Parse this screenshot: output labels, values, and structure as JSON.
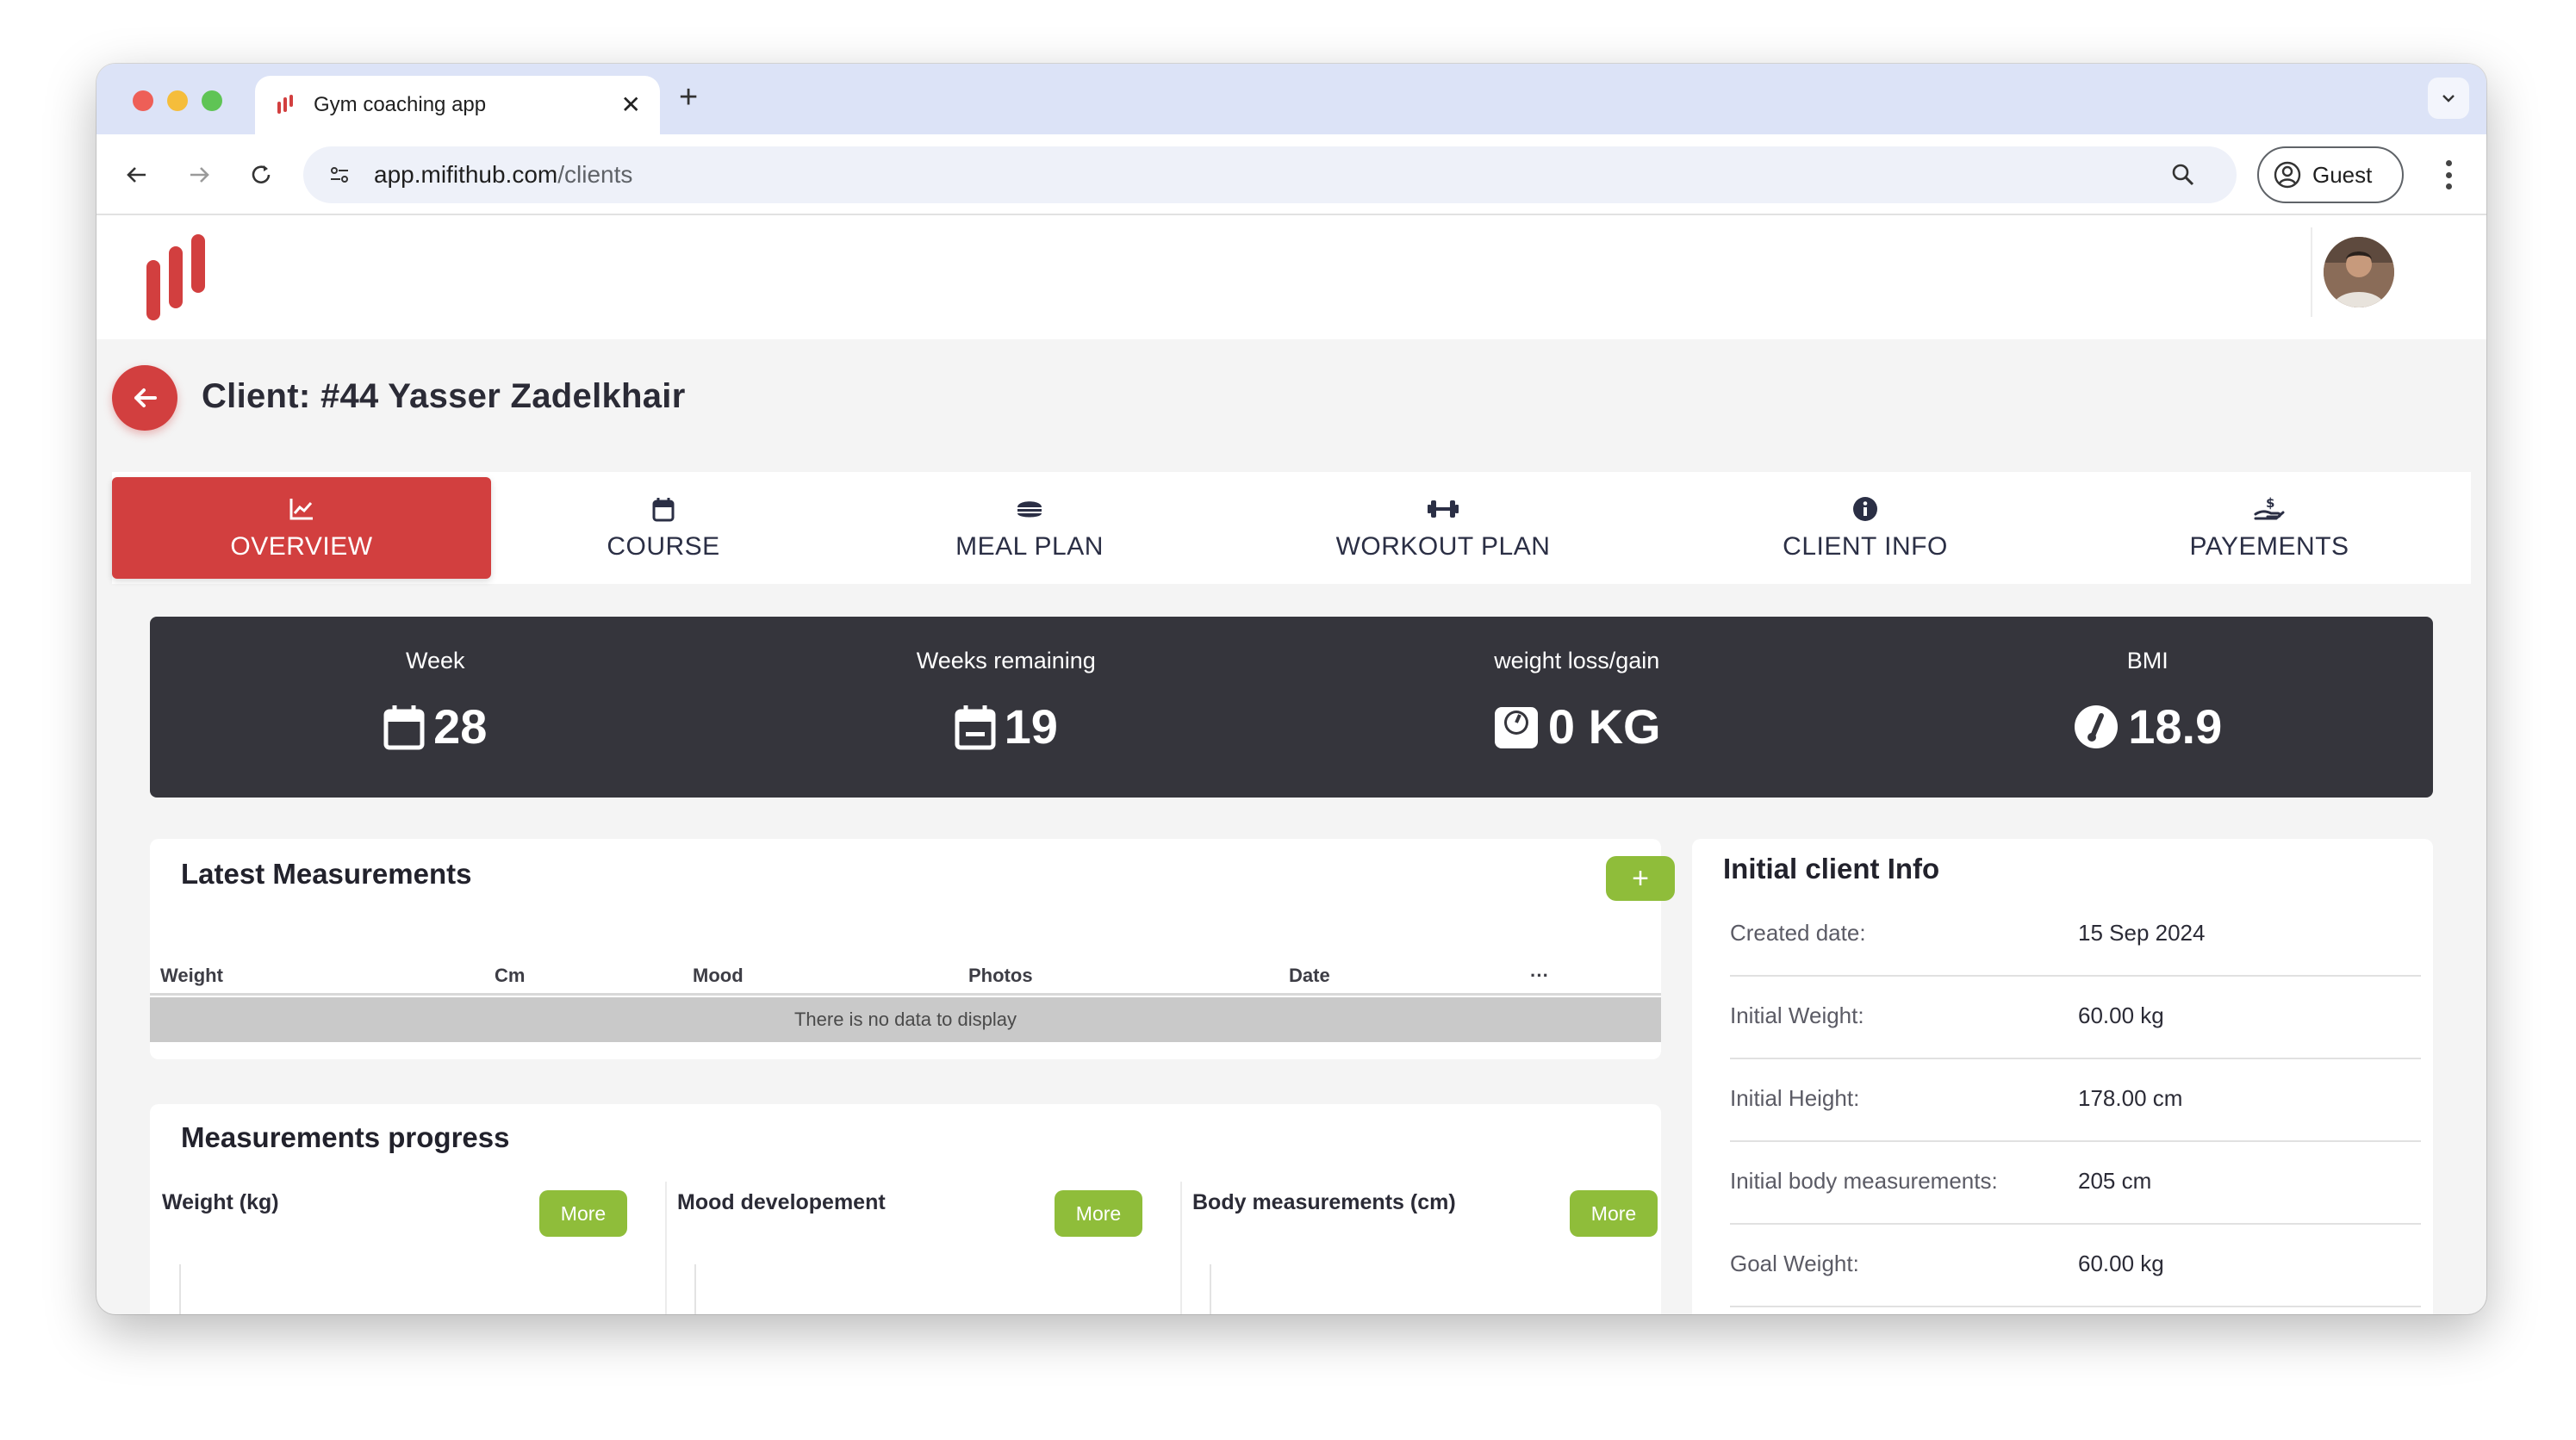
{
  "browser": {
    "tab_title": "Gym coaching app",
    "url_host": "app.mifithub.com",
    "url_path": "/clients",
    "profile_label": "Guest"
  },
  "colors": {
    "brand_red": "#d23f3f",
    "accent_green": "#8fbd3a",
    "banner_dark": "#35353c"
  },
  "page": {
    "title": "Client: #44 Yasser Zadelkhair"
  },
  "tabs": [
    {
      "label": "OVERVIEW",
      "icon": "chart-line-icon",
      "active": true
    },
    {
      "label": "COURSE",
      "icon": "calendar-icon",
      "active": false
    },
    {
      "label": "MEAL PLAN",
      "icon": "burger-icon",
      "active": false
    },
    {
      "label": "WORKOUT PLAN",
      "icon": "dumbbell-icon",
      "active": false
    },
    {
      "label": "CLIENT INFO",
      "icon": "info-circle-icon",
      "active": false
    },
    {
      "label": "PAYEMENTS",
      "icon": "hand-dollar-icon",
      "active": false
    }
  ],
  "stats": [
    {
      "label": "Week",
      "value": "28",
      "icon": "calendar-icon"
    },
    {
      "label": "Weeks remaining",
      "value": "19",
      "icon": "calendar-minus-icon"
    },
    {
      "label": "weight loss/gain",
      "value": "0 KG",
      "icon": "weight-scale-icon"
    },
    {
      "label": "BMI",
      "value": "18.9",
      "icon": "gauge-icon"
    }
  ],
  "latest_measurements": {
    "title": "Latest Measurements",
    "add_label": "+",
    "columns": [
      "Weight",
      "Cm",
      "Mood",
      "Photos",
      "Date",
      "···"
    ],
    "empty_text": "There is no data to display"
  },
  "progress": {
    "title": "Measurements progress",
    "charts": [
      {
        "title": "Weight (kg)",
        "more_label": "More"
      },
      {
        "title": "Mood developement",
        "more_label": "More"
      },
      {
        "title": "Body measurements (cm)",
        "more_label": "More"
      }
    ]
  },
  "initial_info": {
    "title": "Initial client Info",
    "rows": [
      {
        "key": "Created date:",
        "value": "15 Sep 2024"
      },
      {
        "key": "Initial Weight:",
        "value": "60.00 kg"
      },
      {
        "key": "Initial Height:",
        "value": "178.00 cm"
      },
      {
        "key": "Initial body measurements:",
        "value": "205 cm"
      },
      {
        "key": "Goal Weight:",
        "value": "60.00 kg"
      }
    ]
  }
}
